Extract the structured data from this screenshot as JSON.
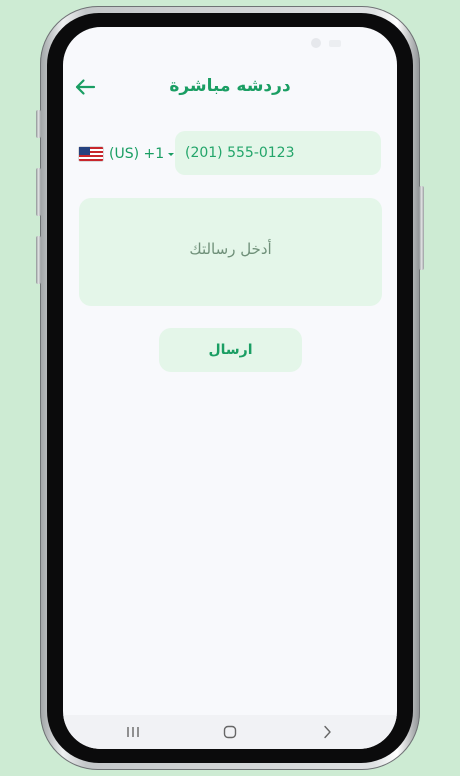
{
  "header": {
    "title": "دردشه مباشرة",
    "back_icon": "arrow-left-icon"
  },
  "phone": {
    "country_flag": "us-flag-icon",
    "dial_code": "(US) +1",
    "placeholder": "(201) 555-0123"
  },
  "message": {
    "placeholder": "أدخل رسالتك"
  },
  "send": {
    "label": "ارسال"
  },
  "nav": {
    "recents_icon": "recents-icon",
    "home_icon": "home-icon",
    "back_icon": "chevron-right-icon"
  },
  "colors": {
    "accent": "#1a9e63",
    "field_bg": "#e4f6e9",
    "page_bg": "#cdebd3",
    "screen_bg": "#f8f9fc"
  }
}
